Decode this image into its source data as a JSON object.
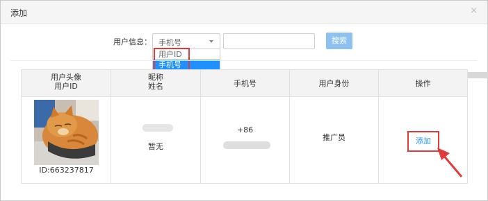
{
  "dialog": {
    "title": "添加",
    "close_icon": "×"
  },
  "search": {
    "label": "用户信息：",
    "selected": "手机号",
    "options": [
      "用户ID",
      "手机号"
    ],
    "button": "搜索"
  },
  "table": {
    "headers": {
      "avatar_line1": "用户头像",
      "avatar_line2": "用户ID",
      "nick_line1": "昵称",
      "nick_line2": "姓名",
      "phone": "手机号",
      "identity": "用户身份",
      "action": "操作"
    },
    "row": {
      "user_id": "ID:663237817",
      "name": "暂无",
      "phone_prefix": "+86",
      "identity": "推广员",
      "action": "添加"
    }
  },
  "colors": {
    "accent": "#1e90ff",
    "highlight": "#e23b3b",
    "button": "#8ec1f0"
  }
}
